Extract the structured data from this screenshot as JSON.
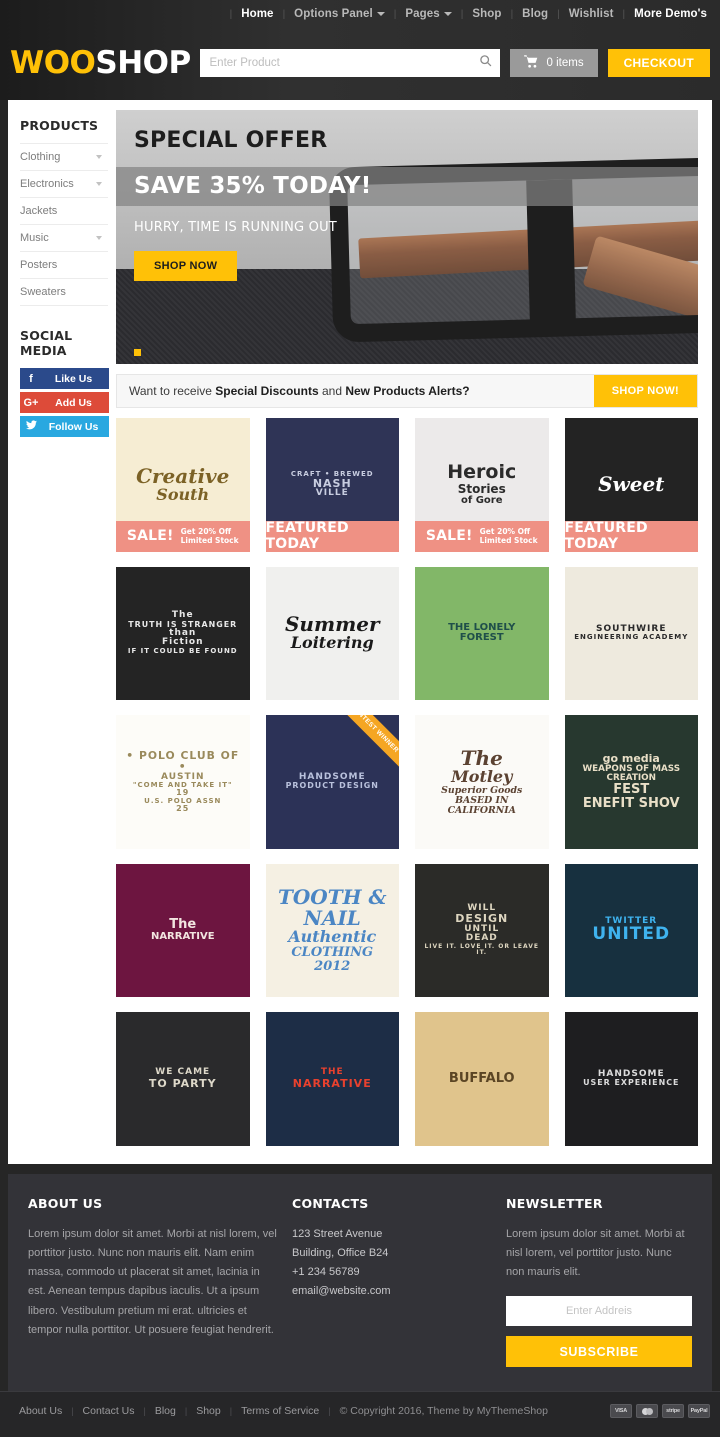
{
  "header": {
    "nav": [
      {
        "label": "Home",
        "active": true,
        "caret": false
      },
      {
        "label": "Options Panel",
        "active": false,
        "caret": true
      },
      {
        "label": "Pages",
        "active": false,
        "caret": true
      },
      {
        "label": "Shop",
        "active": false,
        "caret": false
      },
      {
        "label": "Blog",
        "active": false,
        "caret": false
      },
      {
        "label": "Wishlist",
        "active": false,
        "caret": false
      },
      {
        "label": "More Demo's",
        "active": true,
        "caret": false
      }
    ],
    "logo_woo": "WOO",
    "logo_shop": "SHOP",
    "search_placeholder": "Enter Product",
    "cart_label": "0 items",
    "checkout_label": "CHECKOUT",
    "accent": "#ffc107"
  },
  "sidebar": {
    "products_title": "PRODUCTS",
    "categories": [
      {
        "label": "Clothing",
        "caret": true
      },
      {
        "label": "Electronics",
        "caret": true
      },
      {
        "label": "Jackets",
        "caret": false
      },
      {
        "label": "Music",
        "caret": true
      },
      {
        "label": "Posters",
        "caret": false
      },
      {
        "label": "Sweaters",
        "caret": false
      }
    ],
    "social_title": "SOCIAL MEDIA",
    "social": [
      {
        "icon": "f",
        "label": "Like Us",
        "color": "#2b4a8b",
        "name": "facebook"
      },
      {
        "icon": "G+",
        "label": "Add Us",
        "color": "#dd4b39",
        "name": "googleplus"
      },
      {
        "icon": "✉",
        "label": "Follow Us",
        "color": "#29a8e0",
        "name": "twitter"
      }
    ]
  },
  "hero": {
    "title": "SPECIAL OFFER",
    "subtitle": "SAVE 35% TODAY!",
    "tagline": "HURRY, TIME IS RUNNING OUT",
    "cta": "SHOP NOW",
    "dots": 1
  },
  "promo": {
    "text_1": "Want to receive ",
    "bold_1": "Special Discounts",
    "text_2": " and ",
    "bold_2": "New Products Alerts?",
    "button": "SHOP NOW!"
  },
  "products": [
    {
      "name": "creative-south",
      "lines": [
        "Creative",
        "South"
      ],
      "bg": "#f6edd3",
      "fg": "#7c6226",
      "style": "script",
      "badge": {
        "main": "SALE!",
        "sub1": "Get 20% Off",
        "sub2": "Limited Stock"
      }
    },
    {
      "name": "nashville-craft-brewed",
      "lines": [
        "CRAFT • BREWED",
        "NASH",
        "VILLE"
      ],
      "bg": "#2f3456",
      "fg": "#c8cde0",
      "style": "crest",
      "badge": {
        "main": "FEATURED TODAY",
        "sub1": "",
        "sub2": ""
      }
    },
    {
      "name": "heroic-stories",
      "lines": [
        "Heroic",
        "Stories",
        "of Gore"
      ],
      "bg": "#eceaea",
      "fg": "#2b2b2b",
      "style": "ornate",
      "badge": {
        "main": "SALE!",
        "sub1": "Get 20% Off",
        "sub2": "Limited Stock"
      }
    },
    {
      "name": "sweet",
      "lines": [
        "Sweet"
      ],
      "bg": "#232323",
      "fg": "#ffffff",
      "style": "script",
      "badge": {
        "main": "FEATURED TODAY",
        "sub1": "",
        "sub2": ""
      }
    },
    {
      "name": "truth-is-stranger-than-fiction",
      "lines": [
        "The",
        "TRUTH IS STRANGER",
        "than",
        "Fiction",
        "IF IT COULD BE FOUND"
      ],
      "bg": "#242424",
      "fg": "#e8e8e8",
      "style": "crest",
      "badge": null
    },
    {
      "name": "summer-loitering",
      "lines": [
        "Summer",
        "Loitering"
      ],
      "bg": "#f0f0ee",
      "fg": "#1a1a1a",
      "style": "script",
      "badge": null
    },
    {
      "name": "the-lonely-forest",
      "lines": [
        "THE LONELY",
        "FOREST"
      ],
      "bg": "#82b768",
      "fg": "#1f4f4a",
      "style": "guitar",
      "badge": null
    },
    {
      "name": "southwire-engineering-academy",
      "lines": [
        "SOUTHWIRE",
        "ENGINEERING ACADEMY"
      ],
      "bg": "#eeeade",
      "fg": "#2a2a2a",
      "style": "badge",
      "badge": null
    },
    {
      "name": "polo-club-of-austin",
      "lines": [
        "• POLO CLUB OF •",
        "AUSTIN",
        "\"COME AND TAKE IT\"",
        "19",
        "U.S. POLO ASSN",
        "25"
      ],
      "bg": "#fdfcf8",
      "fg": "#9a8a5c",
      "style": "outline",
      "badge": null
    },
    {
      "name": "handsome-product-design",
      "lines": [
        "HANDSOME",
        "PRODUCT DESIGN"
      ],
      "bg": "#2c3257",
      "fg": "#b9c1dc",
      "style": "crest",
      "badge": null,
      "ribbon": "CONTEST WINNER"
    },
    {
      "name": "the-motley-superior-goods",
      "lines": [
        "The",
        "Motley",
        "Superior Goods",
        "BASED IN CALIFORNIA"
      ],
      "bg": "#fbfaf7",
      "fg": "#5b4232",
      "style": "script",
      "badge": null
    },
    {
      "name": "weapons-of-mass-creation-fest",
      "lines": [
        "go media",
        "WEAPONS OF MASS CREATION",
        "FEST",
        "ENEFIT SHOV"
      ],
      "bg": "#27382f",
      "fg": "#e9dfc7",
      "style": "poster",
      "badge": null
    },
    {
      "name": "the-narrative-deer",
      "lines": [
        "The",
        "NARRATIVE"
      ],
      "bg": "#6d1540",
      "fg": "#f2e5e0",
      "style": "animal",
      "badge": null
    },
    {
      "name": "tooth-and-nail-authentic-clothing",
      "lines": [
        "TOOTH & NAIL",
        "Authentic",
        "CLOTHING",
        "2012"
      ],
      "bg": "#f5f0e3",
      "fg": "#4b86c4",
      "style": "script",
      "badge": null
    },
    {
      "name": "will-design-until-dead",
      "lines": [
        "WILL",
        "DESIGN",
        "UNTIL",
        "DEAD",
        "LIVE IT. LOVE IT. OR LEAVE IT."
      ],
      "bg": "#2b2b28",
      "fg": "#ded6c0",
      "style": "crest",
      "badge": null
    },
    {
      "name": "twitter-united",
      "lines": [
        "TWITTER",
        "UNITED"
      ],
      "bg": "#17303f",
      "fg": "#3fb3ef",
      "style": "anchor",
      "badge": null
    },
    {
      "name": "we-came-to-party",
      "lines": [
        "WE CAME",
        "TO PARTY"
      ],
      "bg": "#2a2a2c",
      "fg": "#ddd8c9",
      "style": "crest",
      "badge": null
    },
    {
      "name": "the-narrative-pens",
      "lines": [
        "THE",
        "NARRATIVE"
      ],
      "bg": "#1d2d46",
      "fg": "#e8412e",
      "style": "crest",
      "badge": null
    },
    {
      "name": "buffalo",
      "lines": [
        "BUFFALO"
      ],
      "bg": "#e0c48c",
      "fg": "#5b4524",
      "style": "animal",
      "badge": null
    },
    {
      "name": "handsome-user-experience",
      "lines": [
        "HANDSOME",
        "USER EXPERIENCE"
      ],
      "bg": "#1e1e20",
      "fg": "#dcdcdc",
      "style": "crest",
      "badge": null
    }
  ],
  "footer": {
    "about_title": "ABOUT US",
    "about_text": "Lorem ipsum dolor sit amet. Morbi at nisl lorem, vel porttitor justo. Nunc non mauris elit. Nam enim massa, commodo ut placerat sit amet, lacinia in est. Aenean tempus dapibus iaculis. Ut a ipsum libero. Vestibulum pretium mi erat. ultricies et tempor nulla porttitor. Ut posuere feugiat hendrerit.",
    "contacts_title": "CONTACTS",
    "contacts": [
      "123 Street Avenue",
      "Building, Office B24",
      "+1 234 56789",
      "email@website.com"
    ],
    "newsletter_title": "NEWSLETTER",
    "newsletter_text": "Lorem ipsum dolor sit amet. Morbi at nisl lorem, vel porttitor justo. Nunc non mauris elit.",
    "newsletter_placeholder": "Enter Addreis",
    "subscribe_label": "SUBSCRIBE"
  },
  "bottombar": {
    "links": [
      "About Us",
      "Contact Us",
      "Blog",
      "Shop",
      "Terms of Service"
    ],
    "copyright": "© Copyright 2016, Theme by MyThemeShop",
    "payments": [
      "VISA",
      "mastercard",
      "stripe",
      "PayPal"
    ]
  }
}
